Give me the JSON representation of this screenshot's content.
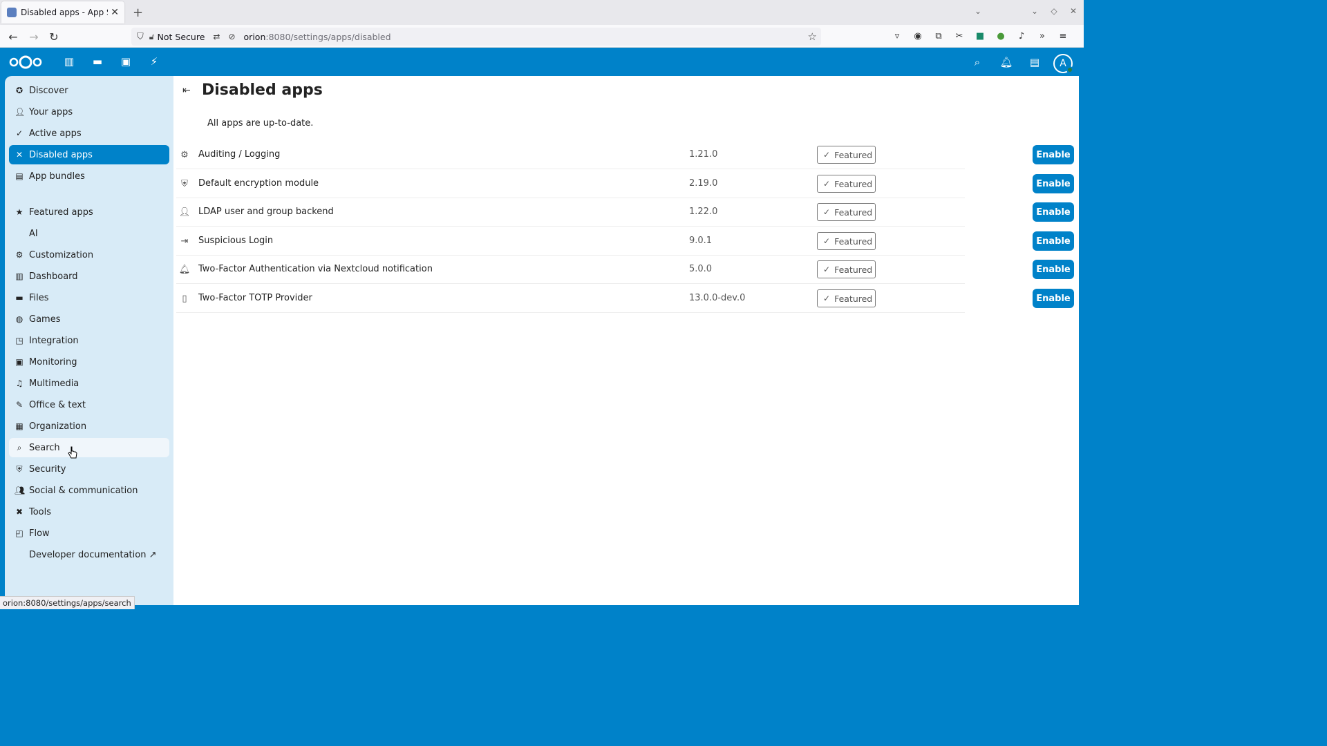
{
  "browser": {
    "tab_title": "Disabled apps - App Store",
    "tab_close": "✕",
    "new_tab": "+",
    "url_security": "Not Secure",
    "url_host": "orion",
    "url_rest": ":8080/settings/apps/disabled",
    "status_url": "orion:8080/settings/apps/search"
  },
  "header": {
    "avatar_letter": "A"
  },
  "sidebar": {
    "items": [
      {
        "label": "Discover",
        "icon": "compass-icon"
      },
      {
        "label": "Your apps",
        "icon": "user-icon"
      },
      {
        "label": "Active apps",
        "icon": "check-icon"
      },
      {
        "label": "Disabled apps",
        "icon": "close-icon"
      },
      {
        "label": "App bundles",
        "icon": "archive-icon"
      },
      {
        "label": "Featured apps",
        "icon": "star-icon"
      },
      {
        "label": "AI",
        "icon": ""
      },
      {
        "label": "Customization",
        "icon": "gear-icon"
      },
      {
        "label": "Dashboard",
        "icon": "dashboard-icon"
      },
      {
        "label": "Files",
        "icon": "folder-icon"
      },
      {
        "label": "Games",
        "icon": "gamepad-icon"
      },
      {
        "label": "Integration",
        "icon": "integration-icon"
      },
      {
        "label": "Monitoring",
        "icon": "monitor-icon"
      },
      {
        "label": "Multimedia",
        "icon": "multimedia-icon"
      },
      {
        "label": "Office & text",
        "icon": "office-icon"
      },
      {
        "label": "Organization",
        "icon": "organization-icon"
      },
      {
        "label": "Search",
        "icon": "search-icon"
      },
      {
        "label": "Security",
        "icon": "shield-icon"
      },
      {
        "label": "Social & communication",
        "icon": "people-icon"
      },
      {
        "label": "Tools",
        "icon": "tools-icon"
      },
      {
        "label": "Flow",
        "icon": "flow-icon"
      },
      {
        "label": "Developer documentation ↗",
        "icon": ""
      }
    ]
  },
  "main": {
    "title": "Disabled apps",
    "status": "All apps are up-to-date.",
    "featured_label": "Featured",
    "enable_label": "Enable",
    "apps": [
      {
        "name": "Auditing / Logging",
        "version": "1.21.0",
        "icon": "gear-icon"
      },
      {
        "name": "Default encryption module",
        "version": "2.19.0",
        "icon": "shield-icon"
      },
      {
        "name": "LDAP user and group backend",
        "version": "1.22.0",
        "icon": "user-icon"
      },
      {
        "name": "Suspicious Login",
        "version": "9.0.1",
        "icon": "login-icon"
      },
      {
        "name": "Two-Factor Authentication via Nextcloud notification",
        "version": "5.0.0",
        "icon": "notification-icon"
      },
      {
        "name": "Two-Factor TOTP Provider",
        "version": "13.0.0-dev.0",
        "icon": "totp-icon"
      }
    ]
  },
  "colors": {
    "brand": "#0082c9",
    "sidebar_bg": "#d8ebf7"
  }
}
